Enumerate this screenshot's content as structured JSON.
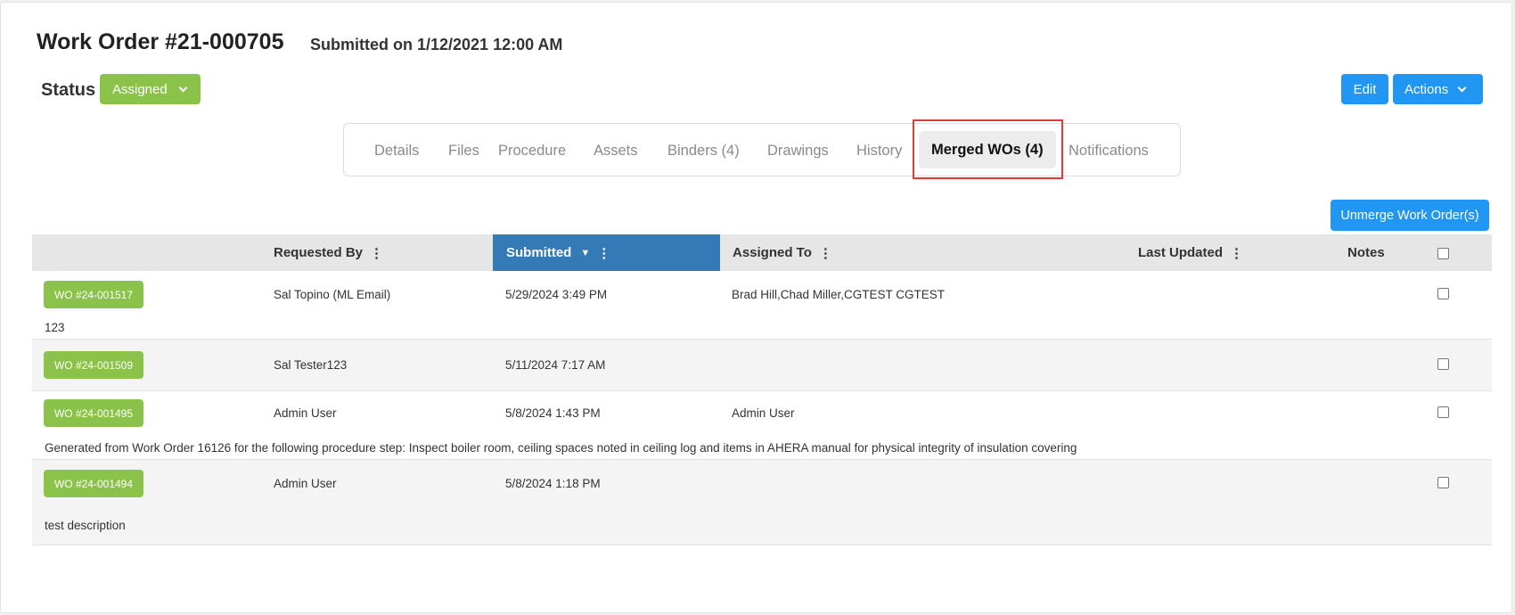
{
  "header": {
    "title": "Work Order #21-000705",
    "subtitle": "Submitted on 1/12/2021 12:00 AM",
    "status_label": "Status",
    "status_value": "Assigned",
    "edit_label": "Edit",
    "actions_label": "Actions"
  },
  "tabs": [
    {
      "label": "Details"
    },
    {
      "label": "Files"
    },
    {
      "label": "Procedure"
    },
    {
      "label": "Assets"
    },
    {
      "label": "Binders (4)"
    },
    {
      "label": "Drawings"
    },
    {
      "label": "History"
    },
    {
      "label": "Merged WOs (4)",
      "active": true
    },
    {
      "label": "Notifications"
    }
  ],
  "toolbar": {
    "unmerge_label": "Unmerge Work Order(s)"
  },
  "table": {
    "columns": {
      "requested_by": "Requested By",
      "submitted": "Submitted",
      "assigned_to": "Assigned To",
      "last_updated": "Last Updated",
      "notes": "Notes"
    },
    "sorted_column": "Submitted",
    "sort_direction": "descending",
    "rows": [
      {
        "wo": "WO #24-001517",
        "requested_by": "Sal Topino (ML Email)",
        "submitted": "5/29/2024 3:49 PM",
        "assigned_to": "Brad Hill,Chad Miller,CGTEST CGTEST",
        "last_updated": "",
        "notes": "",
        "description": "123"
      },
      {
        "wo": "WO #24-001509",
        "requested_by": "Sal Tester123",
        "submitted": "5/11/2024 7:17 AM",
        "assigned_to": "",
        "last_updated": "",
        "notes": "",
        "description": ""
      },
      {
        "wo": "WO #24-001495",
        "requested_by": "Admin User",
        "submitted": "5/8/2024 1:43 PM",
        "assigned_to": "Admin User",
        "last_updated": "",
        "notes": "",
        "description": "Generated from Work Order 16126 for the following procedure step: Inspect boiler room, ceiling spaces noted in ceiling log and items in AHERA manual for physical integrity of insulation covering"
      },
      {
        "wo": "WO #24-001494",
        "requested_by": "Admin User",
        "submitted": "5/8/2024 1:18 PM",
        "assigned_to": "",
        "last_updated": "",
        "notes": "",
        "description": "test description"
      }
    ]
  },
  "colors": {
    "status_green": "#8bc34a",
    "primary_blue": "#2196f3",
    "sorted_header_blue": "#337ab7",
    "highlight_red": "#e53935"
  },
  "icons": [
    "chevron-down-icon",
    "kebab-menu-icon",
    "sort-down-icon",
    "checkbox-icon"
  ]
}
